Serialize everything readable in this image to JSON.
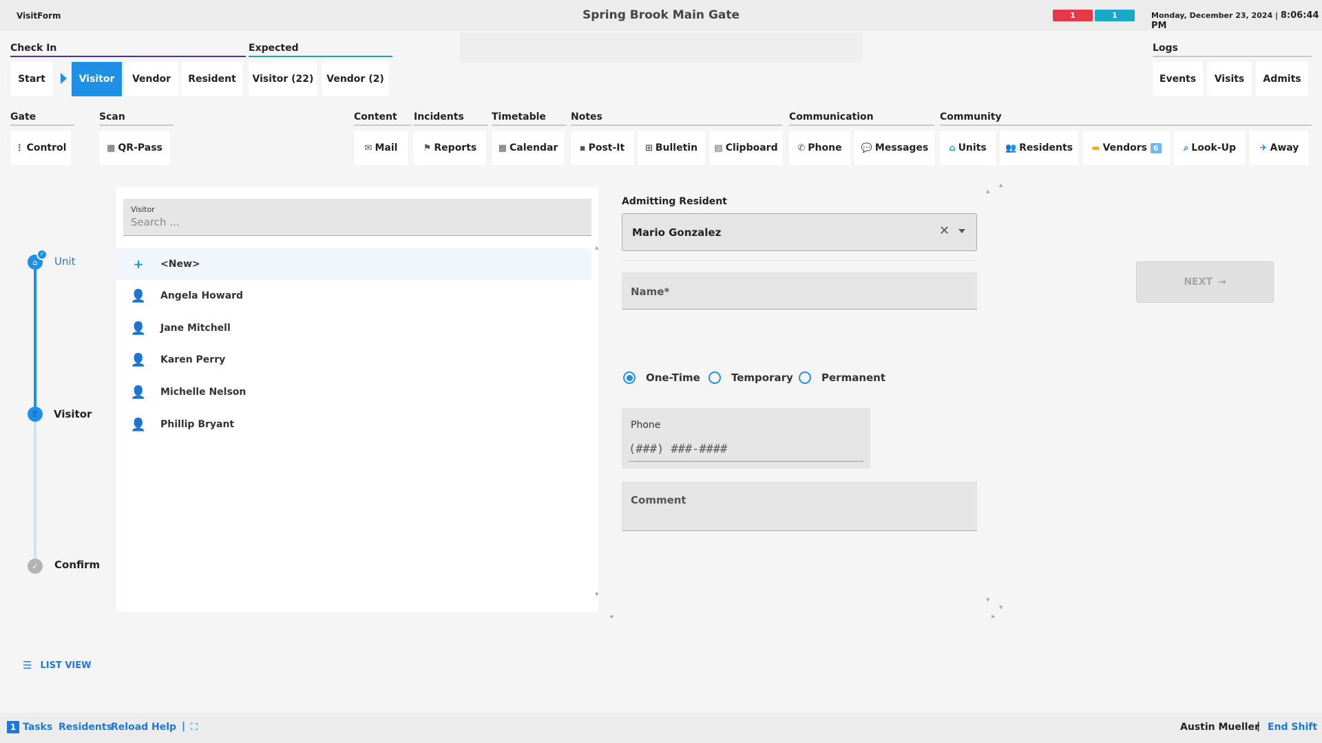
{
  "header": {
    "app_name": "VisitForm",
    "gate_name": "Spring Brook Main Gate",
    "alert_red": "1",
    "alert_teal": "1",
    "date": "Monday, December 23, 2024",
    "separator": "|",
    "time": "8:06:44 PM",
    "colors": {
      "red": "#e53948",
      "teal": "#19a8c5",
      "accent": "#1e90e6"
    }
  },
  "sections": {
    "check_in": "Check In",
    "expected": "Expected",
    "logs": "Logs",
    "gate": "Gate",
    "scan": "Scan",
    "content": "Content",
    "incidents": "Incidents",
    "timetable": "Timetable",
    "notes": "Notes",
    "communication": "Communication",
    "community": "Community"
  },
  "checkin_tabs": {
    "start": "Start",
    "visitor": "Visitor",
    "vendor": "Vendor",
    "resident": "Resident"
  },
  "expected_tabs": {
    "visitor": "Visitor (22)",
    "vendor": "Vendor (2)"
  },
  "log_tabs": {
    "events": "Events",
    "visits": "Visits",
    "admits": "Admits"
  },
  "tools": {
    "control": "Control",
    "qr_pass": "QR-Pass",
    "mail": "Mail",
    "reports": "Reports",
    "calendar": "Calendar",
    "post_it": "Post-It",
    "bulletin": "Bulletin",
    "clipboard": "Clipboard",
    "phone": "Phone",
    "messages": "Messages",
    "units": "Units",
    "residents": "Residents",
    "vendors": "Vendors",
    "vendors_count": "6",
    "look_up": "Look-Up",
    "away": "Away"
  },
  "icons": {
    "control": "⋮",
    "qr": "▦",
    "mail": "✉",
    "reports": "⚑",
    "calendar": "▦",
    "post_it": "▪",
    "bulletin": "⊞",
    "clipboard": "▤",
    "phone": "✆",
    "messages": "💬",
    "units": "⌂",
    "residents": "👥",
    "vendors": "▬",
    "look_up": "⌕",
    "away": "✈",
    "person": "👤",
    "add": "+",
    "check": "✓",
    "clear": "✕",
    "arrow_right": "→",
    "list": "☰",
    "fullscreen": "⛶"
  },
  "stepper": {
    "unit": "Unit",
    "visitor": "Visitor",
    "confirm": "Confirm"
  },
  "visitor_search": {
    "label": "Visitor",
    "placeholder": "Search ..."
  },
  "visitor_list": {
    "new": "<New>",
    "names": [
      "Angela Howard",
      "Jane Mitchell",
      "Karen Perry",
      "Michelle Nelson",
      "Phillip Bryant"
    ]
  },
  "form": {
    "admitting_label": "Admitting Resident",
    "admitting_value": "Mario Gonzalez",
    "name_label": "Name*",
    "visit_types": [
      "One-Time",
      "Temporary",
      "Permanent"
    ],
    "visit_type_selected": "One-Time",
    "phone_label": "Phone",
    "phone_mask": "(###) ###-####",
    "comment_label": "Comment",
    "next_label": "NEXT"
  },
  "list_view": "LIST VIEW",
  "footer": {
    "task_count": "1",
    "tasks": "Tasks",
    "residents": "Residents",
    "reload": "Reload",
    "help": "Help",
    "separator": "|",
    "user": "Austin Mueller",
    "end_shift": "End Shift"
  }
}
